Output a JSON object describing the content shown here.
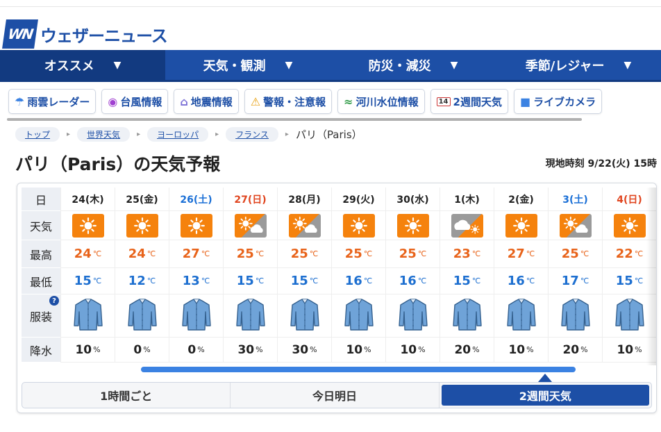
{
  "site": {
    "logo_mark": "WN",
    "logo_text": "ウェザーニュース"
  },
  "mainnav": [
    {
      "label": "オススメ",
      "arrow": "▼"
    },
    {
      "label": "天気・観測",
      "arrow": "▼"
    },
    {
      "label": "防災・減災",
      "arrow": "▼"
    },
    {
      "label": "季節/レジャー",
      "arrow": "▼"
    }
  ],
  "subnav": [
    {
      "icon": "☂",
      "label": "雨雲レーダー"
    },
    {
      "icon": "◉",
      "label": "台風情報"
    },
    {
      "icon": "⌂",
      "label": "地震情報"
    },
    {
      "icon": "⚠",
      "label": "警報・注意報"
    },
    {
      "icon": "≈",
      "label": "河川水位情報"
    },
    {
      "icon": "14",
      "label": "2週間天気"
    },
    {
      "icon": "■",
      "label": "ライブカメラ"
    }
  ],
  "breadcrumb": {
    "links": [
      "トップ",
      "世界天気",
      "ヨーロッパ",
      "フランス"
    ],
    "sep": "▸",
    "current": "パリ（Paris）"
  },
  "title": "パリ（Paris）の天気予報",
  "local_time": "現地時刻 9/22(火) 15時",
  "row_labels": {
    "day": "日",
    "weather": "天気",
    "high": "最高",
    "low": "最低",
    "clothes": "服装",
    "rain": "降水",
    "help": "?"
  },
  "units": {
    "temp": "℃",
    "rain": "%"
  },
  "days": [
    {
      "date": "24(木)",
      "type": "wk",
      "wx": "sunny",
      "hi": "24",
      "lo": "15",
      "rain": "10"
    },
    {
      "date": "25(金)",
      "type": "wk",
      "wx": "sunny",
      "hi": "24",
      "lo": "12",
      "rain": "0"
    },
    {
      "date": "26(土)",
      "type": "sat",
      "wx": "sunny",
      "hi": "27",
      "lo": "13",
      "rain": "0"
    },
    {
      "date": "27(日)",
      "type": "sun",
      "wx": "sunny-cloudy",
      "hi": "25",
      "lo": "15",
      "rain": "30"
    },
    {
      "date": "28(月)",
      "type": "wk",
      "wx": "sunny-cloudy",
      "hi": "25",
      "lo": "15",
      "rain": "30"
    },
    {
      "date": "29(火)",
      "type": "wk",
      "wx": "sunny",
      "hi": "25",
      "lo": "16",
      "rain": "10"
    },
    {
      "date": "30(水)",
      "type": "wk",
      "wx": "sunny",
      "hi": "25",
      "lo": "16",
      "rain": "10"
    },
    {
      "date": "1(木)",
      "type": "wk",
      "wx": "cloudy-sunny",
      "hi": "23",
      "lo": "15",
      "rain": "20"
    },
    {
      "date": "2(金)",
      "type": "wk",
      "wx": "sunny",
      "hi": "27",
      "lo": "16",
      "rain": "10"
    },
    {
      "date": "3(土)",
      "type": "sat",
      "wx": "sunny-cloudy",
      "hi": "25",
      "lo": "17",
      "rain": "20"
    },
    {
      "date": "4(日)",
      "type": "sun",
      "wx": "sunny",
      "hi": "22",
      "lo": "15",
      "rain": "10"
    }
  ],
  "tabs": [
    {
      "label": "1時間ごと",
      "active": false
    },
    {
      "label": "今日明日",
      "active": false
    },
    {
      "label": "2週間天気",
      "active": true
    }
  ],
  "colors": {
    "brand": "#1d4fa6",
    "sunny_bg": "#f5820d",
    "cloudy_bg": "#9a9a9a",
    "high": "#e8631a",
    "low": "#1d6fd0"
  }
}
